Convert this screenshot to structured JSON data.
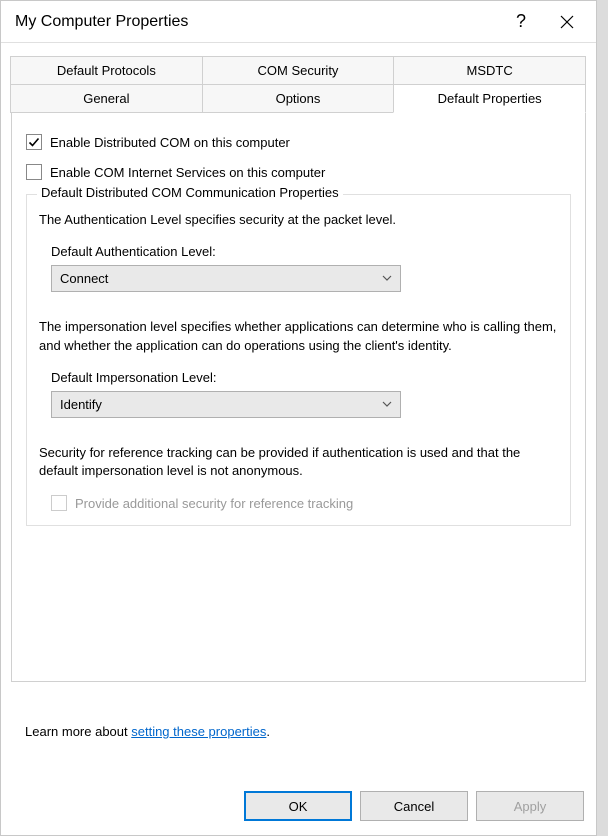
{
  "window": {
    "title": "My Computer Properties"
  },
  "tabs": {
    "row1": [
      "Default Protocols",
      "COM Security",
      "MSDTC"
    ],
    "row2": [
      "General",
      "Options",
      "Default Properties"
    ],
    "active": "Default Properties"
  },
  "panel": {
    "enable_dcom_label": "Enable Distributed COM on this computer",
    "enable_internet_label": "Enable COM Internet Services on this computer",
    "group_title": "Default Distributed COM Communication Properties",
    "auth_desc": "The Authentication Level specifies security at the packet level.",
    "auth_label": "Default Authentication Level:",
    "auth_value": "Connect",
    "imp_desc": "The impersonation level specifies whether applications can determine who is calling them, and whether the application can do operations using the client's identity.",
    "imp_label": "Default Impersonation Level:",
    "imp_value": "Identify",
    "sec_text": "Security for reference tracking can be provided if authentication is used and that the default impersonation level is not anonymous.",
    "ref_checkbox_label": "Provide additional security for reference tracking"
  },
  "learn_more": {
    "prefix": "Learn more about ",
    "link": "setting these properties",
    "suffix": "."
  },
  "buttons": {
    "ok": "OK",
    "cancel": "Cancel",
    "apply": "Apply"
  }
}
